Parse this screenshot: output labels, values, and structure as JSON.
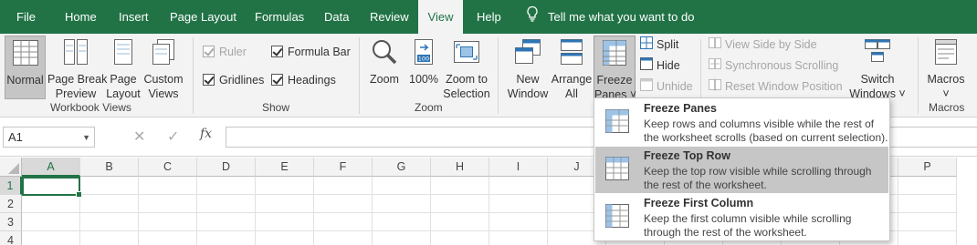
{
  "menu": {
    "tabs": [
      {
        "label": "File"
      },
      {
        "label": "Home"
      },
      {
        "label": "Insert"
      },
      {
        "label": "Page Layout"
      },
      {
        "label": "Formulas"
      },
      {
        "label": "Data"
      },
      {
        "label": "Review"
      },
      {
        "label": "View"
      },
      {
        "label": "Help"
      }
    ],
    "tell_me": "Tell me what you want to do"
  },
  "ribbon": {
    "workbook_views": {
      "label": "Workbook Views",
      "normal": "Normal",
      "page_break_1": "Page Break",
      "page_break_2": "Preview",
      "page_layout_1": "Page",
      "page_layout_2": "Layout",
      "custom_1": "Custom",
      "custom_2": "Views"
    },
    "show": {
      "label": "Show",
      "ruler": "Ruler",
      "formula_bar": "Formula Bar",
      "gridlines": "Gridlines",
      "headings": "Headings"
    },
    "zoom": {
      "label": "Zoom",
      "zoom": "Zoom",
      "hundred": "100%",
      "hundred_icon_text": "100",
      "zoom_sel_1": "Zoom to",
      "zoom_sel_2": "Selection"
    },
    "window": {
      "new_1": "New",
      "new_2": "Window",
      "arrange_1": "Arrange",
      "arrange_2": "All",
      "freeze_1": "Freeze",
      "freeze_2": "Panes ˅",
      "split": "Split",
      "hide": "Hide",
      "unhide": "Unhide",
      "side_by_side": "View Side by Side",
      "sync_scroll": "Synchronous Scrolling",
      "reset_pos": "Reset Window Position",
      "switch_1": "Switch",
      "switch_2": "Windows ˅"
    },
    "macros": {
      "label": "Macros",
      "btn_1": "Macros",
      "btn_2": "˅"
    }
  },
  "formula_bar": {
    "name_box": "A1",
    "cancel": "✕",
    "enter": "✓",
    "fx": "fx",
    "value": ""
  },
  "grid": {
    "columns": [
      "A",
      "B",
      "C",
      "D",
      "E",
      "F",
      "G",
      "H",
      "I",
      "J",
      "K",
      "L",
      "M",
      "N",
      "O",
      "P"
    ],
    "rows": [
      "1",
      "2",
      "3",
      "4"
    ]
  },
  "freeze_menu": {
    "items": [
      {
        "title": "Freeze Panes",
        "desc": "Keep rows and columns visible while the rest of the worksheet scrolls (based on current selection)."
      },
      {
        "title": "Freeze Top Row",
        "desc": "Keep the top row visible while scrolling through the rest of the worksheet."
      },
      {
        "title": "Freeze First Column",
        "desc": "Keep the first column visible while scrolling through the rest of the worksheet."
      }
    ]
  },
  "colors": {
    "brand_green": "#217346",
    "ribbon_bg": "#f3f3f3",
    "hover_gray": "#c6c6c6"
  },
  "icons": [
    "bulb-icon",
    "normal-view-icon",
    "page-break-icon",
    "page-layout-icon",
    "custom-views-icon",
    "zoom-icon",
    "zoom-100-icon",
    "zoom-selection-icon",
    "new-window-icon",
    "arrange-all-icon",
    "freeze-panes-icon",
    "split-icon",
    "hide-icon",
    "unhide-icon",
    "side-by-side-icon",
    "sync-scroll-icon",
    "reset-position-icon",
    "switch-windows-icon",
    "macros-icon"
  ]
}
